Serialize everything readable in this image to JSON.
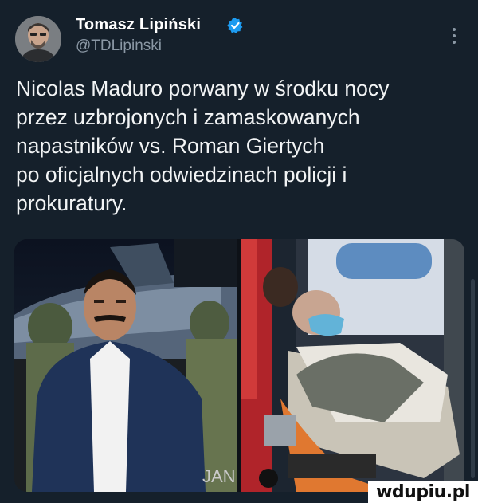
{
  "author": {
    "name": "Tomasz Lipiński",
    "handle": "@TDLipinski",
    "verified_color": "#1d9bf0"
  },
  "tweet": {
    "lines": [
      "Nicolas Maduro porwany w środku nocy",
      "przez uzbrojonych i zamaskowanych",
      "napastników vs. Roman Giertych",
      "po oficjalnych odwiedzinach policji i",
      "prokuratury."
    ]
  },
  "media": {
    "image_icon_left": "photo-maduro",
    "image_icon_right": "photo-giertych",
    "left_caption_fragment": "JAN"
  },
  "watermark": {
    "text": "wdupiu.pl"
  },
  "colors": {
    "background": "#15202b",
    "text": "#ffffff",
    "secondary_text": "#8b98a5",
    "accent": "#1d9bf0"
  }
}
